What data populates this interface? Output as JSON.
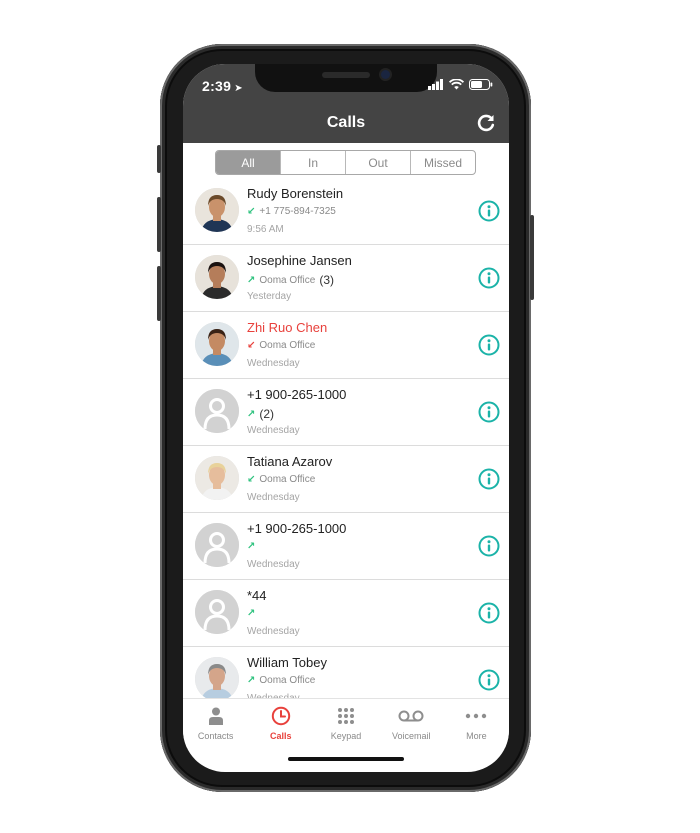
{
  "status_bar": {
    "time": "2:39",
    "location_icon": "location-arrow-icon",
    "icons": [
      "signal-icon",
      "wifi-icon",
      "battery-icon"
    ]
  },
  "header": {
    "title": "Calls",
    "refresh_icon": "refresh-icon"
  },
  "filter": {
    "segments": [
      {
        "label": "All",
        "active": true
      },
      {
        "label": "In",
        "active": false
      },
      {
        "label": "Out",
        "active": false
      },
      {
        "label": "Missed",
        "active": false
      }
    ]
  },
  "calls": [
    {
      "name": "Rudy Borenstein",
      "direction": "incoming",
      "line": "+1 775-894-7325",
      "count": "",
      "when": "9:56 AM",
      "missed": false,
      "avatar": "photo"
    },
    {
      "name": "Josephine Jansen",
      "direction": "outgoing",
      "line": "Ooma Office",
      "count": "(3)",
      "when": "Yesterday",
      "missed": false,
      "avatar": "photo"
    },
    {
      "name": "Zhi Ruo Chen",
      "direction": "missed",
      "line": "Ooma Office",
      "count": "",
      "when": "Wednesday",
      "missed": true,
      "avatar": "photo"
    },
    {
      "name": "+1 900-265-1000",
      "direction": "outgoing",
      "line": "",
      "count": "(2)",
      "when": "Wednesday",
      "missed": false,
      "avatar": "placeholder"
    },
    {
      "name": "Tatiana Azarov",
      "direction": "incoming",
      "line": "Ooma Office",
      "count": "",
      "when": "Wednesday",
      "missed": false,
      "avatar": "photo"
    },
    {
      "name": "+1 900-265-1000",
      "direction": "outgoing",
      "line": "",
      "count": "",
      "when": "Wednesday",
      "missed": false,
      "avatar": "placeholder"
    },
    {
      "name": "*44",
      "direction": "outgoing",
      "line": "",
      "count": "",
      "when": "Wednesday",
      "missed": false,
      "avatar": "placeholder"
    },
    {
      "name": "William Tobey",
      "direction": "outgoing",
      "line": "Ooma Office",
      "count": "",
      "when": "Wednesday",
      "missed": false,
      "avatar": "photo"
    }
  ],
  "tabbar": {
    "tabs": [
      {
        "label": "Contacts",
        "icon": "person-icon",
        "active": false
      },
      {
        "label": "Calls",
        "icon": "clock-icon",
        "active": true
      },
      {
        "label": "Keypad",
        "icon": "keypad-icon",
        "active": false
      },
      {
        "label": "Voicemail",
        "icon": "voicemail-icon",
        "active": false
      },
      {
        "label": "More",
        "icon": "more-icon",
        "active": false
      }
    ]
  },
  "colors": {
    "header_bg": "#444444",
    "accent_info": "#1bb3a8",
    "missed_red": "#e8413c",
    "incoming_green": "#2ec27e",
    "active_segment": "#9b9b9b"
  }
}
